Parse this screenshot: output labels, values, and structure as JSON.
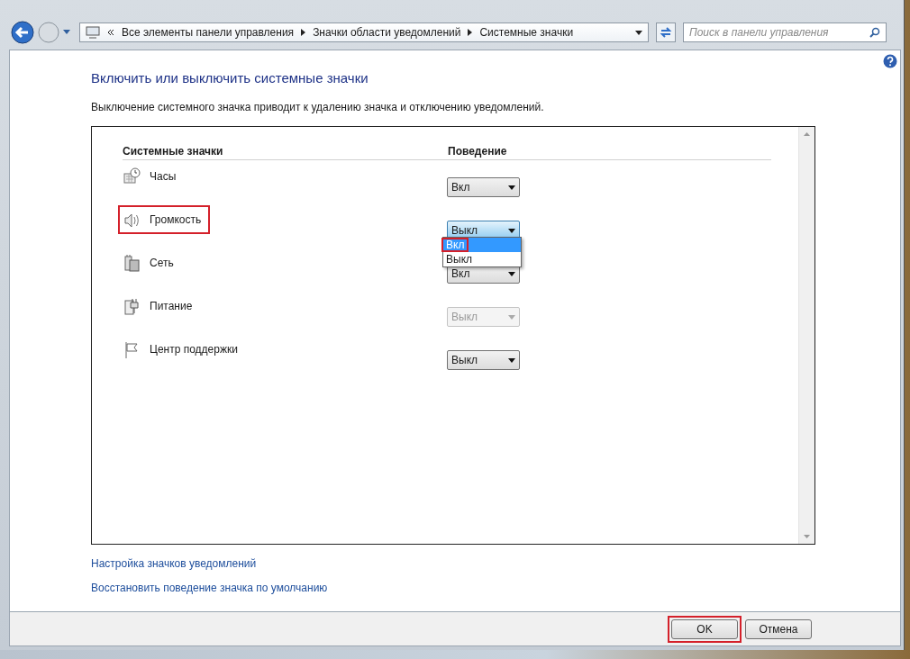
{
  "address_bar": {
    "crumbs": [
      "Все элементы панели управления",
      "Значки области уведомлений",
      "Системные значки"
    ]
  },
  "search": {
    "placeholder": "Поиск в панели управления"
  },
  "heading": "Включить или выключить системные значки",
  "description": "Выключение системного значка приводит к удалению значка и отключению уведомлений.",
  "table": {
    "columns": [
      "Системные значки",
      "Поведение"
    ],
    "rows": [
      {
        "kind": "clock",
        "name": "Часы",
        "value": "Вкл",
        "disabled": false,
        "focused": false,
        "highlighted": false
      },
      {
        "kind": "volume",
        "name": "Громкость",
        "value": "Выкл",
        "disabled": false,
        "focused": true,
        "highlighted": true,
        "dropdown": {
          "options": [
            {
              "label": "Вкл",
              "selected": true,
              "highlighted": true
            },
            {
              "label": "Выкл",
              "selected": false,
              "highlighted": false
            }
          ]
        }
      },
      {
        "kind": "network",
        "name": "Сеть",
        "value": "Вкл",
        "disabled": false,
        "focused": false,
        "highlighted": false
      },
      {
        "kind": "power",
        "name": "Питание",
        "value": "Выкл",
        "disabled": true,
        "focused": false,
        "highlighted": false
      },
      {
        "kind": "flag",
        "name": "Центр поддержки",
        "value": "Выкл",
        "disabled": false,
        "focused": false,
        "highlighted": false
      }
    ]
  },
  "links": [
    "Настройка значков уведомлений",
    "Восстановить поведение значка по умолчанию"
  ],
  "buttons": [
    {
      "label": "OK",
      "highlighted": true
    },
    {
      "label": "Отмена",
      "highlighted": false
    }
  ]
}
